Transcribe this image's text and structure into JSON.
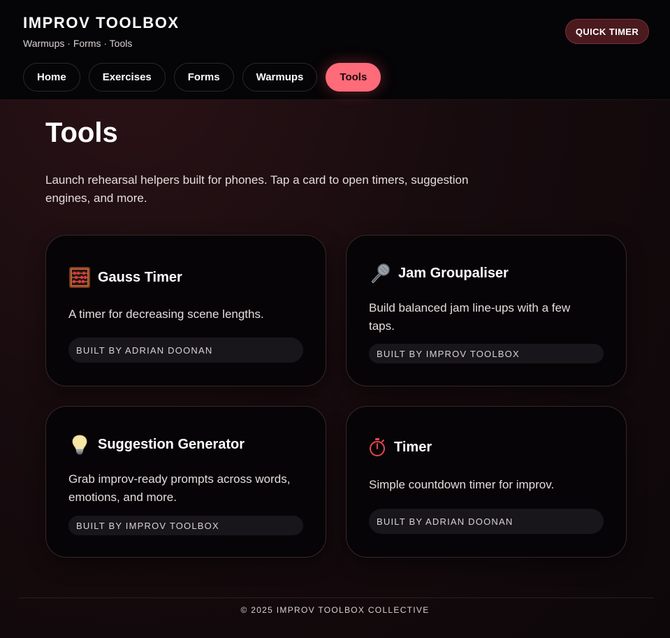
{
  "header": {
    "title": "IMPROV TOOLBOX",
    "subtitle": "Warmups · Forms · Tools",
    "quick_timer_label": "QUICK TIMER"
  },
  "nav": {
    "tabs": [
      {
        "label": "Home"
      },
      {
        "label": "Exercises"
      },
      {
        "label": "Forms"
      },
      {
        "label": "Warmups"
      },
      {
        "label": "Tools",
        "active": true
      }
    ]
  },
  "main": {
    "title": "Tools",
    "intro": "Launch rehearsal helpers built for phones. Tap a card to open timers, suggestion engines, and more."
  },
  "cards": [
    {
      "icon": "abacus-icon",
      "title": "Gauss Timer",
      "description": "A timer for decreasing scene lengths.",
      "credit": "BUILT BY ADRIAN DOONAN"
    },
    {
      "icon": "microphone-icon",
      "title": "Jam Groupaliser",
      "description": "Build balanced jam line-ups with a few taps.",
      "credit": "BUILT BY IMPROV TOOLBOX"
    },
    {
      "icon": "light-bulb-icon",
      "title": "Suggestion Generator",
      "description": "Grab improv-ready prompts across words, emotions, and more.",
      "credit": "BUILT BY IMPROV TOOLBOX"
    },
    {
      "icon": "stopwatch-icon",
      "title": "Timer",
      "description": "Simple countdown timer for improv.",
      "credit": "BUILT BY ADRIAN DOONAN"
    }
  ],
  "footer": {
    "text": "© 2025 IMPROV TOOLBOX COLLECTIVE"
  },
  "colors": {
    "accent": "#ff6b78",
    "quick_timer_bg": "#4a1a1f",
    "card_bg": "#060406",
    "page_bg": "#170b0e"
  }
}
